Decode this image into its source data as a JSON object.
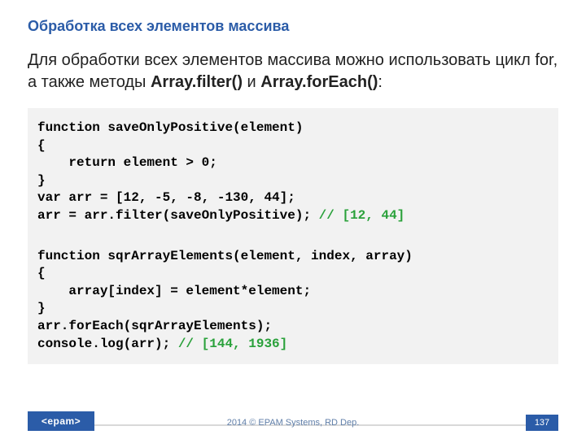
{
  "title": "Обработка всех элементов массива",
  "body": {
    "pre": "Для обработки всех элементов массива можно использовать цикл for, а также методы ",
    "bold1": "Array.filter()",
    "mid": " и ",
    "bold2": "Array.forEach()",
    "post": ":"
  },
  "code": {
    "l1": "function saveOnlyPositive(element)",
    "l2": "{",
    "l3": "    return element > 0;",
    "l4": "}",
    "l5": "var arr = [12, -5, -8, -130, 44];",
    "l6a": "arr = arr.filter(saveOnlyPositive); ",
    "l6b": "// [12, 44]",
    "l7": "function sqrArrayElements(element, index, array)",
    "l8": "{",
    "l9": "    array[index] = element*element;",
    "l10": "}",
    "l11": "arr.forEach(sqrArrayElements);",
    "l12a": "console.log(arr); ",
    "l12b": "// [144, 1936]"
  },
  "footer": {
    "logo": "<epam>",
    "copyright": "2014 © EPAM Systems, RD Dep.",
    "page": "137"
  }
}
